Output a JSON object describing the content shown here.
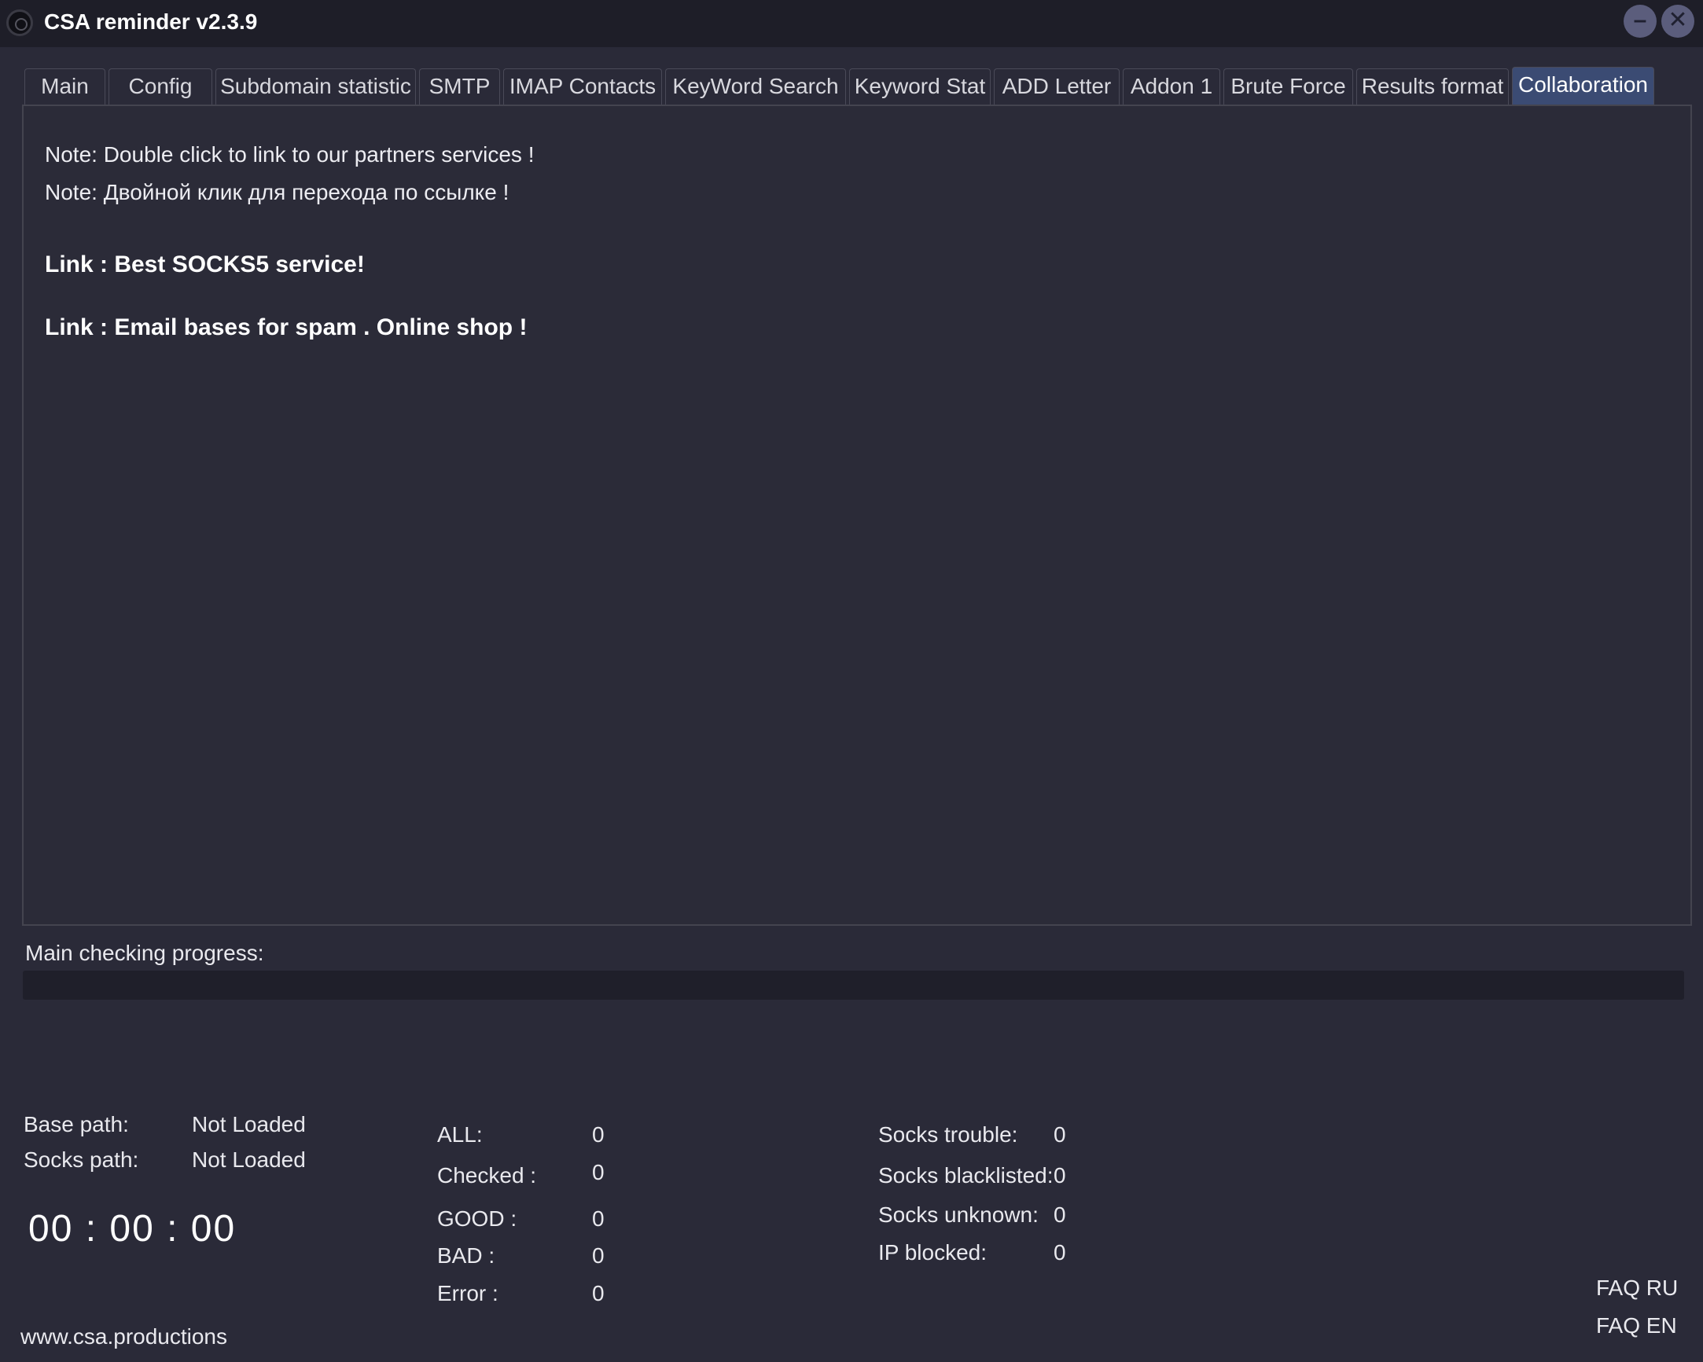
{
  "window": {
    "title": "CSA reminder v2.3.9",
    "minimize_symbol": "–",
    "close_symbol": "✕"
  },
  "tabs": [
    {
      "label": "Main"
    },
    {
      "label": "Config"
    },
    {
      "label": "Subdomain statistic"
    },
    {
      "label": "SMTP"
    },
    {
      "label": "IMAP Contacts"
    },
    {
      "label": "KeyWord Search"
    },
    {
      "label": "Keyword Stat"
    },
    {
      "label": "ADD Letter"
    },
    {
      "label": "Addon 1"
    },
    {
      "label": "Brute Force"
    },
    {
      "label": "Results format"
    },
    {
      "label": "Collaboration",
      "active": true
    }
  ],
  "collaboration": {
    "note_en": "Note: Double click to link to our partners services !",
    "note_ru": "Note: Двойной клик для перехода по ссылке !",
    "links": [
      "Link : Best SOCKS5 service!",
      "Link : Email bases for spam . Online shop !"
    ]
  },
  "progress": {
    "label": "Main checking progress:",
    "value": 0
  },
  "paths": {
    "base_label": "Base path:",
    "base_value": "Not Loaded",
    "socks_label": "Socks path:",
    "socks_value": "Not Loaded"
  },
  "timer": "00 : 00 : 00",
  "stats": {
    "all_label": "ALL:",
    "all_value": "0",
    "checked_label": "Checked :",
    "checked_value": "0",
    "good_label": "GOOD :",
    "good_value": "0",
    "bad_label": "BAD :",
    "bad_value": "0",
    "error_label": "Error :",
    "error_value": "0"
  },
  "socks": {
    "trouble_label": "Socks trouble:",
    "trouble_value": "0",
    "blacklisted_label": "Socks blacklisted:",
    "blacklisted_value": "0",
    "unknown_label": "Socks unknown:",
    "unknown_value": "0",
    "ip_blocked_label": "IP blocked:",
    "ip_blocked_value": "0"
  },
  "footer": {
    "website": "www.csa.productions",
    "faq_ru": "FAQ RU",
    "faq_en": "FAQ EN"
  },
  "colors": {
    "background": "#2a2a38",
    "titlebar": "#1e1e28",
    "active_tab": "#3b4b73",
    "progress_track": "#1f1f2a"
  }
}
